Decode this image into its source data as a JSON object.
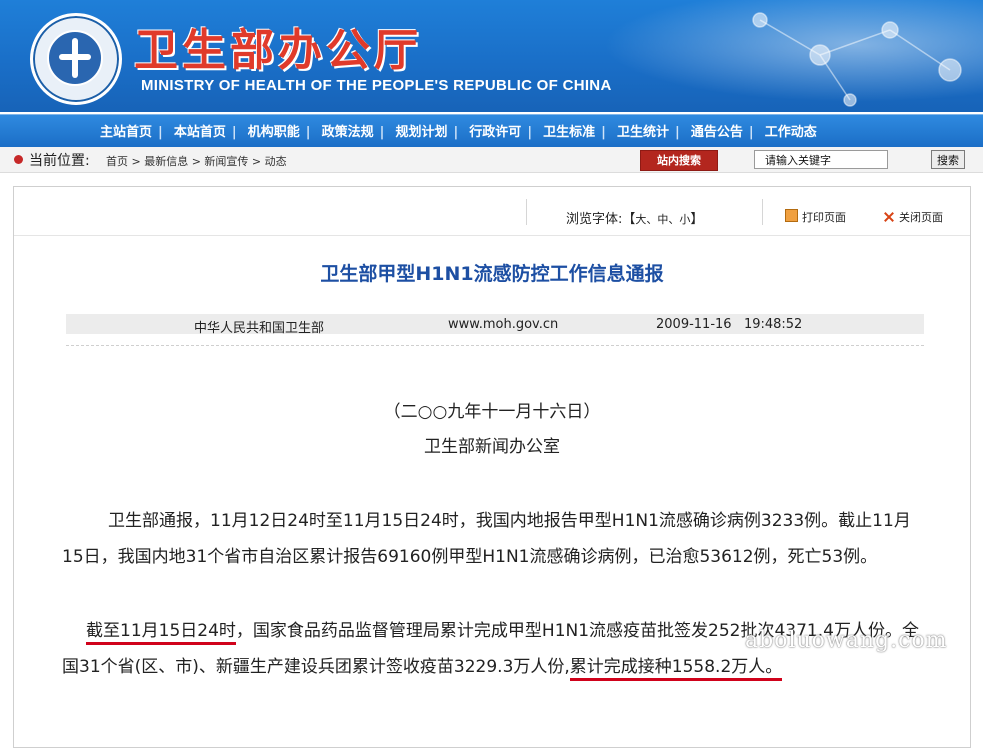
{
  "header": {
    "site_title": "卫生部办公厅",
    "site_subtitle": "MINISTRY OF HEALTH OF THE PEOPLE'S REPUBLIC OF CHINA"
  },
  "nav": {
    "items": [
      "主站首页",
      "本站首页",
      "机构职能",
      "政策法规",
      "规划计划",
      "行政许可",
      "卫生标准",
      "卫生统计",
      "通告公告",
      "工作动态"
    ],
    "separator": "|"
  },
  "location": {
    "label": "当前位置:",
    "breadcrumb": "首页 > 最新信息 > 新闻宣传 > 动态"
  },
  "search": {
    "site_search_label": "站内搜索",
    "input_value": "请输入关键字",
    "button_label": "搜索"
  },
  "toolbar": {
    "font_label": "浏览字体:【",
    "font_large": "大",
    "font_medium": "中",
    "font_small": "小",
    "font_close": "】",
    "font_sep": "、",
    "print_label": "打印页面",
    "close_label": "关闭页面"
  },
  "article": {
    "title": "卫生部甲型H1N1流感防控工作信息通报",
    "source": "中华人民共和国卫生部",
    "website": "www.moh.gov.cn",
    "datetime": "2009-11-16   19:48:52",
    "date_line": "（二○○九年十一月十六日）",
    "office_line": "卫生部新闻办公室",
    "paragraph1": "卫生部通报，11月12日24时至11月15日24时，我国内地报告甲型H1N1流感确诊病例3233例。截止11月15日，我国内地31个省市自治区累计报告69160例甲型H1N1流感确诊病例，已治愈53612例，死亡53例。",
    "p2_underlined_start": "截至11月15日24时",
    "p2_middle": "，国家食品药品监督管理局累计完成甲型H1N1流感疫苗批签发252批次4371.4万人份。全国31个省(区、市)、新疆生产建设兵团累计签收疫苗3229.3万人份,",
    "p2_underlined_end": "累计完成接种1558.2万人。"
  },
  "watermark": "aboluowang.com",
  "colors": {
    "banner_blue": "#1a6fc8",
    "title_red": "#e03a2a",
    "article_title_blue": "#1d4fa3",
    "underline_red": "#d0021b",
    "search_button_red": "#b3261e"
  }
}
